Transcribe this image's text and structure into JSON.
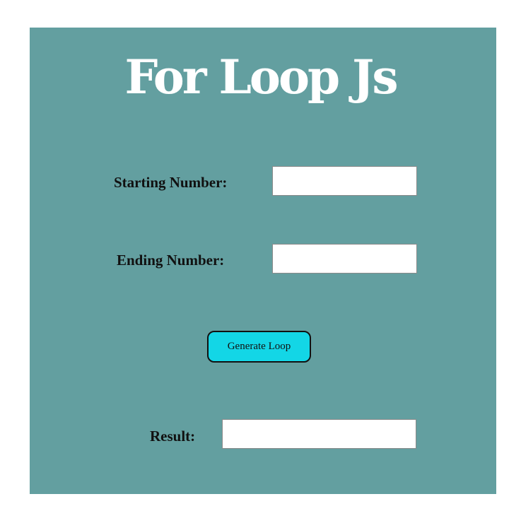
{
  "title": "For Loop Js",
  "form": {
    "start_label": "Starting Number:",
    "start_value": "",
    "end_label": "Ending Number:",
    "end_value": "",
    "button_label": "Generate Loop",
    "result_label": "Result:",
    "result_value": ""
  },
  "colors": {
    "panel": "#639fa0",
    "button": "#13d6e6",
    "title": "#ffffff"
  }
}
